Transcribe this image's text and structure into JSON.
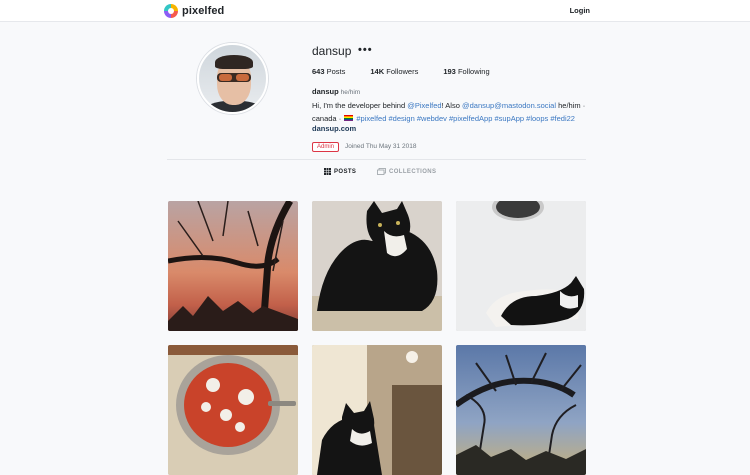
{
  "header": {
    "brand": "pixelfed",
    "login_label": "Login"
  },
  "profile": {
    "username": "dansup",
    "more_label": "•••",
    "stats": {
      "posts_count": "643",
      "posts_label": "Posts",
      "followers_count": "14K",
      "followers_label": "Followers",
      "following_count": "193",
      "following_label": "Following"
    },
    "display_name": "dansup",
    "pronouns": "he/him",
    "bio": {
      "t1": "Hi, I'm the developer behind ",
      "m1": "@Pixelfed",
      "t2": "! Also ",
      "m2": "@dansup@mastodon.social",
      "t3": " he/him · canada · ",
      "h1": "#pixelfed",
      "h2": "#design",
      "h3": "#webdev",
      "h4": "#pixelfedApp",
      "h5": "#supApp",
      "h6": "#loops",
      "h7": "#fedi22"
    },
    "website": "dansup.com",
    "admin_badge": "Admin",
    "joined": "Joined Thu May 31 2018"
  },
  "tabs": {
    "posts_label": "POSTS",
    "collections_label": "COLLECTIONS"
  },
  "posts": [
    {
      "subject": "bare tree silhouette at sunset"
    },
    {
      "subject": "black and white cat on cushion"
    },
    {
      "subject": "black and white cat lying under mirror"
    },
    {
      "subject": "shakshuka in a pan"
    },
    {
      "subject": "black and white cat near window"
    },
    {
      "subject": "tree branches against blue sky"
    }
  ],
  "colors": {
    "link": "#3b78c2",
    "admin": "#dc3545",
    "background": "#f8f9fb"
  }
}
